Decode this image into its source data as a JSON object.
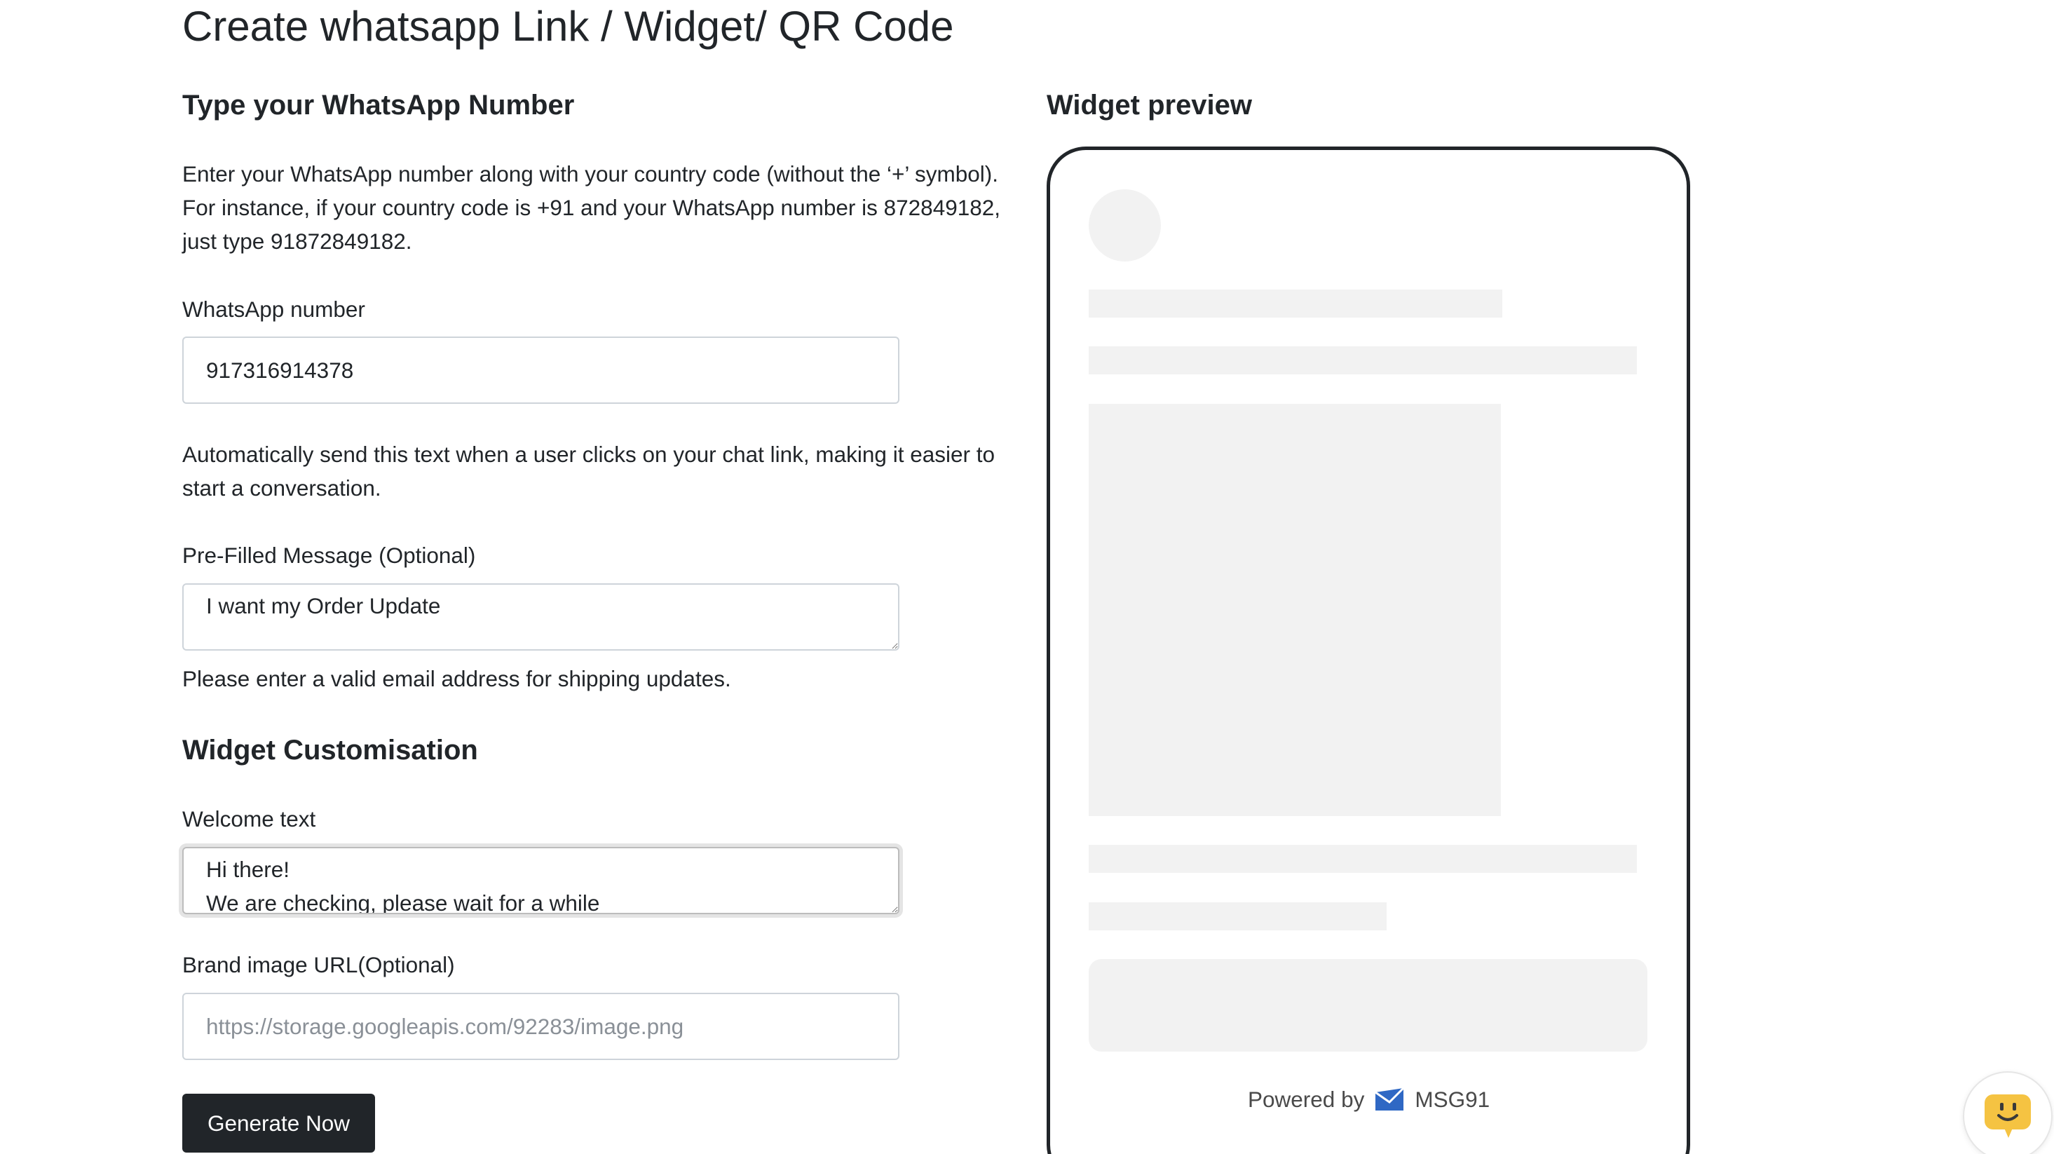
{
  "page": {
    "title": "Create whatsapp Link / Widget/ QR Code"
  },
  "number_section": {
    "heading": "Type your WhatsApp Number",
    "description": "Enter your WhatsApp number along with your country code (without the ‘+’ symbol). For instance, if your country code is +91 and your WhatsApp number is 872849182, just type 91872849182.",
    "field_label": "WhatsApp number",
    "field_value": "917316914378"
  },
  "message_section": {
    "description": "Automatically send this text when a user clicks on your chat link, making it easier to start a conversation.",
    "field_label": "Pre-Filled Message (Optional)",
    "field_value": "I want my Order Update",
    "helper_text": "Please enter a valid email address for shipping updates."
  },
  "customisation": {
    "heading": "Widget Customisation",
    "welcome_label": "Welcome text",
    "welcome_value": "Hi there!\nWe are checking, please wait for a while",
    "brand_label": "Brand image URL(Optional)",
    "brand_placeholder": "https://storage.googleapis.com/92283/image.png",
    "generate_button": "Generate Now"
  },
  "preview": {
    "heading": "Widget preview",
    "powered_by": "Powered by",
    "brand_name": "MSG91",
    "logo_icon": "msg91-envelope-icon"
  },
  "feedback_widget": {
    "icon": "smiley-chat-icon",
    "color": "#f5c342"
  }
}
